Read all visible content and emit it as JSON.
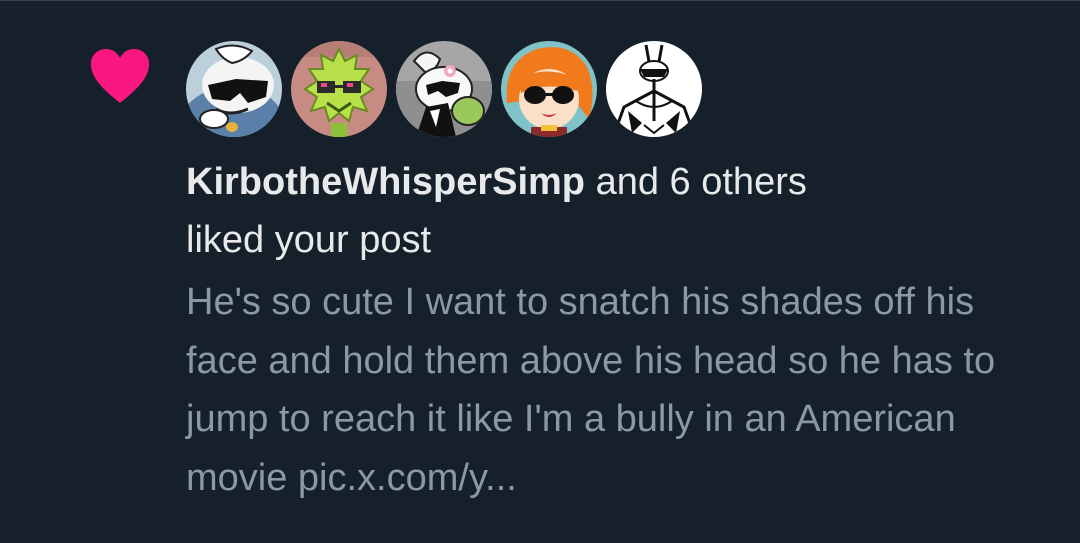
{
  "notification": {
    "type": "like",
    "icon": "heart-icon",
    "accent_color": "#f91880",
    "background_color": "#15202b",
    "avatars": [
      {
        "name": "avatar-1",
        "description": "white cartoon character with black sunglasses"
      },
      {
        "name": "avatar-2",
        "description": "green pixel art character with sunglasses"
      },
      {
        "name": "avatar-3",
        "description": "white character with flower"
      },
      {
        "name": "avatar-4",
        "description": "orange-haired character with black sunglasses"
      },
      {
        "name": "avatar-5",
        "description": "black and white sketch character"
      }
    ],
    "user_name": "KirbotheWhisperSimp",
    "others_text": " and 6 others",
    "action_text": "liked your post",
    "post_text": "He's so cute I want to snatch his shades off his face and hold them above his head so he has to jump to reach it like I'm a bully in an American movie pic.x.com/y..."
  }
}
